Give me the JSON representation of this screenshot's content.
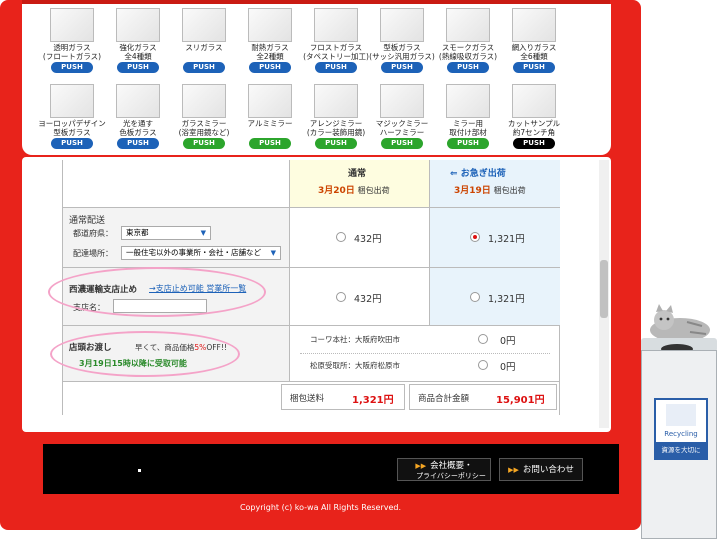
{
  "products_row1": [
    {
      "label": "透明ガラス\n(フロートガラス)",
      "push": "PUSH",
      "color": "blue"
    },
    {
      "label": "強化ガラス\n全4種類",
      "push": "PUSH",
      "color": "blue"
    },
    {
      "label": "スリガラス",
      "push": "PUSH",
      "color": "blue"
    },
    {
      "label": "耐熱ガラス\n全2種類",
      "push": "PUSH",
      "color": "blue"
    },
    {
      "label": "フロストガラス\n(タペストリー加工)",
      "push": "PUSH",
      "color": "blue"
    },
    {
      "label": "型板ガラス\n(サッシ汎用ガラス)",
      "push": "PUSH",
      "color": "blue"
    },
    {
      "label": "スモークガラス\n(熱線吸収ガラス)",
      "push": "PUSH",
      "color": "blue"
    },
    {
      "label": "網入りガラス\n全6種類",
      "push": "PUSH",
      "color": "blue"
    }
  ],
  "products_row2": [
    {
      "label": "ヨーロッパデザイン\n型板ガラス",
      "push": "PUSH",
      "color": "blue"
    },
    {
      "label": "光を通す\n色板ガラス",
      "push": "PUSH",
      "color": "blue"
    },
    {
      "label": "ガラスミラー\n(浴室用鏡など)",
      "push": "PUSH",
      "color": "green"
    },
    {
      "label": "アルミミラー",
      "push": "PUSH",
      "color": "green"
    },
    {
      "label": "アレンジミラー\n(カラー装飾用鏡)",
      "push": "PUSH",
      "color": "green"
    },
    {
      "label": "マジックミラー\nハーフミラー",
      "push": "PUSH",
      "color": "green"
    },
    {
      "label": "ミラー用\n取付け部材",
      "push": "PUSH",
      "color": "green"
    },
    {
      "label": "カットサンプル\n約7センチ角",
      "push": "PUSH",
      "color": "black"
    }
  ],
  "shipping": {
    "normal_title": "通常",
    "normal_date": "3月20日",
    "normal_date_suffix": "梱包出荷",
    "express_title": "お急ぎ出荷",
    "express_date": "3月19日",
    "express_date_suffix": "梱包出荷",
    "row1_title": "通常配送",
    "pref_label": "都道府県：",
    "pref_value": "東京都",
    "place_label": "配達場所：",
    "place_value": "一般住宅以外の事業所・会社・店舗など",
    "row1_price_normal": "432円",
    "row1_price_express": "1,321円",
    "row2_title": "西濃運輸支店止め",
    "row2_link": "→支店止め可能 営業所一覧",
    "branch_label": "支店名：",
    "row2_price_normal": "432円",
    "row2_price_express": "1,321円",
    "row3_title": "店頭お渡し",
    "row3_note_a": "早くて、商品価格",
    "row3_discount": "5%",
    "row3_note_b": "OFF!!",
    "row3_pickup": "3月19日15時以降に受取可能",
    "store1": "コーワ本社：大阪府吹田市",
    "store1_price": "0円",
    "store2": "松原受取所：大阪府松原市",
    "store2_price": "0円",
    "pack_label": "梱包送料",
    "pack_value": "1,321円",
    "total_label": "商品合計金額",
    "total_value": "15,901円"
  },
  "footer": {
    "company_label": "会社概要・",
    "privacy_label": "プライバシーポリシー",
    "contact_label": "お問い合わせ",
    "copyright": "Copyright (c) ko-wa All Rights Reserved."
  },
  "recycle": {
    "label": "Recycling",
    "caption": "資源を大切に"
  }
}
